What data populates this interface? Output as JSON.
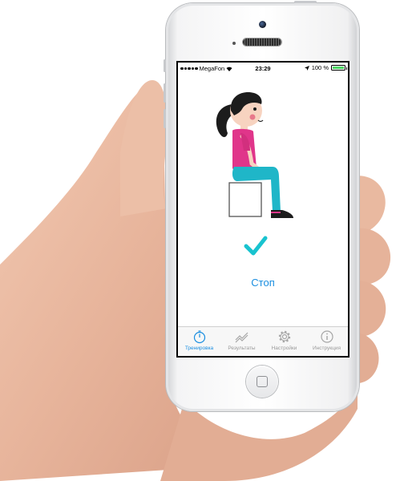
{
  "status_bar": {
    "carrier": "MegaFon",
    "time": "23:29",
    "battery": "100 %",
    "battery_level": 1.0
  },
  "main": {
    "stop_label": "Стоп",
    "check_icon": "checkmark-icon",
    "accent_color": "#1a8ee0",
    "check_color": "#18c3cf"
  },
  "tabbar": {
    "tabs": [
      {
        "label": "Тренировка",
        "icon": "stopwatch-icon",
        "active": true
      },
      {
        "label": "Результаты",
        "icon": "chart-icon",
        "active": false
      },
      {
        "label": "Настройки",
        "icon": "gear-icon",
        "active": false
      },
      {
        "label": "Инструкция",
        "icon": "info-icon",
        "active": false
      }
    ]
  }
}
